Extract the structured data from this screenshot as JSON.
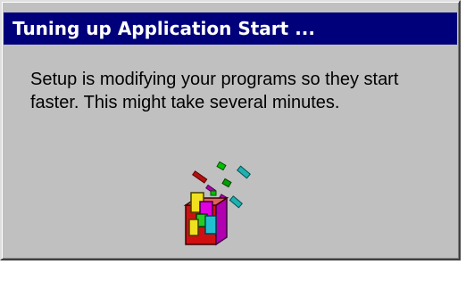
{
  "window": {
    "title": "Tuning up Application Start ...",
    "message_line1": "Setup is modifying your programs so they start",
    "message_line2": "faster. This might take several minutes."
  },
  "icons": {
    "animation": "setup-tuning-animation-icon"
  },
  "colors": {
    "titlebar": "#00007b",
    "dialog_face": "#c0c0c0"
  }
}
